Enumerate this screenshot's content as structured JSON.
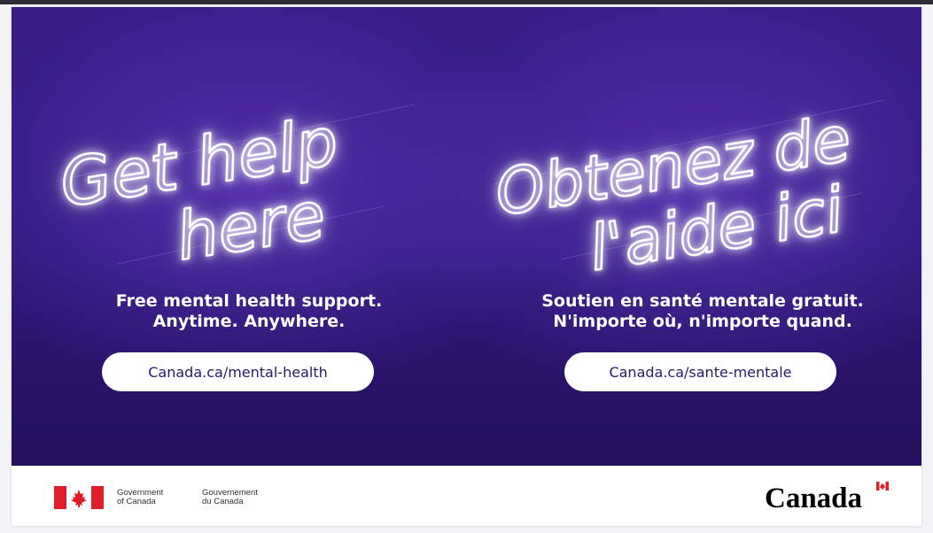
{
  "banner": {
    "english": {
      "headline_line1": "Get help",
      "headline_line2": "here",
      "tagline_line1": "Free mental health support.",
      "tagline_line2": "Anytime. Anywhere.",
      "url_label": "Canada.ca/mental-health"
    },
    "french": {
      "headline_line1": "Obtenez de",
      "headline_line2": "l'aide ici",
      "tagline_line1": "Soutien en santé mentale gratuit.",
      "tagline_line2": "N'importe où, n'importe quand.",
      "url_label": "Canada.ca/sante-mentale"
    }
  },
  "footer": {
    "signature_english_line1": "Government",
    "signature_english_line2": "of Canada",
    "signature_french_line1": "Gouvernement",
    "signature_french_line2": "du Canada",
    "wordmark": "Canada"
  },
  "colors": {
    "banner_background": "#2f1878",
    "neon_glow_pink": "#ff3fd8",
    "neon_glow_blue": "#3fb6ff",
    "pill_text": "#2a1a6e",
    "flag_red": "#e11d2a"
  },
  "icons": {
    "flag": "canada-flag-icon",
    "wordmark_flag": "wordmark-flag-icon"
  }
}
